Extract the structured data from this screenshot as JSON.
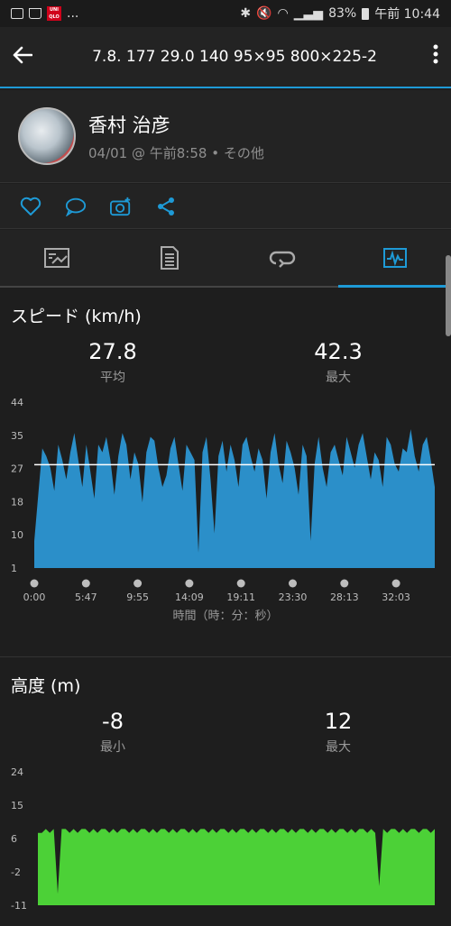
{
  "status": {
    "left": "...",
    "battery": "83%",
    "time": "午前 10:44"
  },
  "appbar": {
    "title": "7.8. 177  29.0  140  95×95  800×225-2"
  },
  "profile": {
    "name": "香村 治彦",
    "meta": "04/01 @ 午前8:58 • その他"
  },
  "actions": [
    "heart-icon",
    "comment-icon",
    "camera-icon",
    "share-icon"
  ],
  "tabs": [
    "summary-tab",
    "details-tab",
    "laps-tab",
    "charts-tab"
  ],
  "speed": {
    "title": "スピード (km/h)",
    "avg_value": "27.8",
    "avg_label": "平均",
    "max_value": "42.3",
    "max_label": "最大",
    "x_label": "時間（時：分：秒）"
  },
  "altitude": {
    "title": "高度 (m)",
    "min_value": "-8",
    "min_label": "最小",
    "max_value": "12",
    "max_label": "最大"
  },
  "chart_data": [
    {
      "type": "area",
      "title": "スピード (km/h)",
      "ylim": [
        1,
        44
      ],
      "yticks": [
        "44",
        "35",
        "27",
        "18",
        "10",
        "1"
      ],
      "xticks": [
        "0:00",
        "5:47",
        "9:55",
        "14:09",
        "19:11",
        "23:30",
        "28:13",
        "32:03"
      ],
      "xlabel": "時間（時：分：秒）",
      "average": 27.8,
      "color": "#2b8fc9",
      "series": [
        {
          "values": [
            8,
            20,
            32,
            30,
            27,
            21,
            33,
            29,
            24,
            31,
            36,
            29,
            22,
            33,
            26,
            19,
            33,
            31,
            35,
            29,
            20,
            30,
            36,
            33,
            24,
            31,
            28,
            18,
            31,
            35,
            34,
            27,
            22,
            25,
            32,
            35,
            28,
            21,
            33,
            31,
            29,
            5,
            31,
            35,
            24,
            10,
            30,
            34,
            26,
            33,
            29,
            22,
            33,
            35,
            30,
            26,
            32,
            29,
            19,
            31,
            36,
            28,
            23,
            34,
            31,
            27,
            20,
            33,
            30,
            8,
            28,
            35,
            27,
            22,
            31,
            33,
            29,
            25,
            35,
            31,
            27,
            33,
            36,
            30,
            24,
            31,
            29,
            22,
            35,
            33,
            28,
            26,
            32,
            31,
            37,
            30,
            26,
            33,
            35,
            29,
            22
          ]
        }
      ]
    },
    {
      "type": "area",
      "title": "高度 (m)",
      "ylim": [
        -11,
        24
      ],
      "yticks": [
        "24",
        "15",
        "6",
        "-2",
        "-11"
      ],
      "color": "#4cd137",
      "series": [
        {
          "values": [
            8,
            8,
            9,
            8,
            9,
            -8,
            9,
            9,
            8,
            9,
            8,
            9,
            9,
            8,
            9,
            8,
            9,
            9,
            8,
            9,
            8,
            9,
            9,
            8,
            9,
            8,
            9,
            9,
            8,
            9,
            8,
            9,
            9,
            8,
            9,
            8,
            9,
            9,
            8,
            9,
            8,
            9,
            9,
            8,
            9,
            8,
            9,
            9,
            8,
            9,
            8,
            9,
            9,
            8,
            9,
            8,
            9,
            9,
            8,
            9,
            8,
            9,
            9,
            8,
            9,
            8,
            9,
            9,
            8,
            9,
            8,
            9,
            9,
            8,
            9,
            8,
            9,
            9,
            8,
            9,
            8,
            9,
            9,
            8,
            9,
            8,
            -6,
            9,
            8,
            9,
            9,
            8,
            9,
            8,
            9,
            9,
            8,
            9,
            9,
            8,
            9
          ]
        }
      ]
    }
  ]
}
